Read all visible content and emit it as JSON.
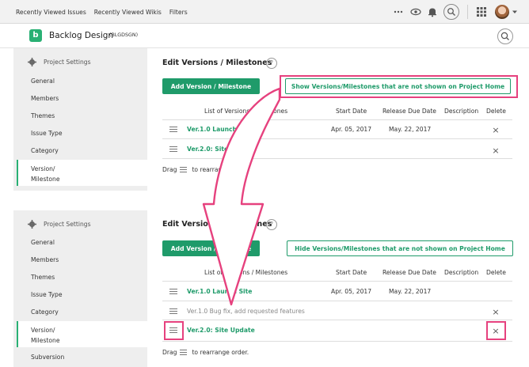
{
  "topnav": {
    "links": [
      "Recently Viewed Issues",
      "Recently Viewed Wikis",
      "Filters"
    ],
    "icons": [
      "more-icon",
      "eye-icon",
      "bell-icon",
      "search-icon",
      "grid-icon",
      "avatar",
      "caret-icon"
    ]
  },
  "project": {
    "logo_letter": "b",
    "name": "Backlog Design",
    "key": "(BLGDSGN)"
  },
  "sidebar": {
    "header": "Project Settings",
    "items": [
      "General",
      "Members",
      "Themes",
      "Issue Type",
      "Category"
    ],
    "active_line1": "Version/",
    "active_line2": "Milestone",
    "next_item": "Subversion"
  },
  "top_panel": {
    "title": "Edit Versions / Milestones",
    "add_button": "Add Version / Milestone",
    "toggle_button": "Show Versions/Milestones that are not shown on Project Home",
    "columns": [
      "List of Versions / Milestones",
      "Start Date",
      "Release Due Date",
      "Description",
      "Delete"
    ],
    "rows": [
      {
        "name": "Ver.1.0 Launch Site",
        "start": "Apr. 05, 2017",
        "due": "May. 22, 2017"
      },
      {
        "name": "Ver.2.0: Site Update",
        "start": "",
        "due": ""
      }
    ],
    "drag_prefix": "Drag",
    "drag_suffix": "to rearrange order."
  },
  "bottom_panel": {
    "title": "Edit Versions / Milestones",
    "add_button": "Add Version / Milestone",
    "toggle_button": "Hide Versions/Milestones that are not shown on Project Home",
    "columns": [
      "List of Versions / Milestones",
      "Start Date",
      "Release Due Date",
      "Description",
      "Delete"
    ],
    "rows": [
      {
        "name": "Ver.1.0 Launch Site",
        "start": "Apr. 05, 2017",
        "due": "May. 22, 2017"
      },
      {
        "name": "Ver.1.0 Bug fix, add requested features"
      },
      {
        "name": "Ver.2.0: Site Update"
      }
    ],
    "delete_glyph": "×",
    "drag_prefix": "Drag",
    "drag_suffix": "to rearrange order."
  },
  "colors": {
    "brand_green": "#1f9b6a",
    "highlight_pink": "#e6417e"
  }
}
